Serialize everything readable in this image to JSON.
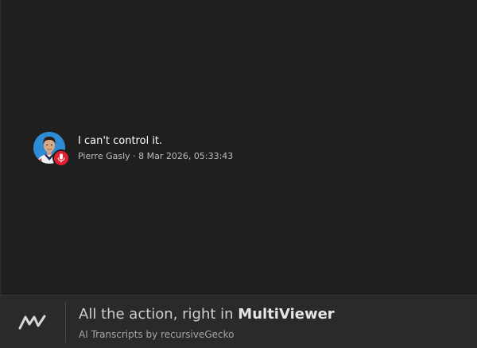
{
  "message": {
    "text": "I can't control it.",
    "author": "Pierre Gasly",
    "separator": " · ",
    "timestamp": "8 Mar 2026, 05:33:43",
    "avatar_icon": "driver-avatar",
    "badge_icon": "microphone-icon",
    "badge_color": "#e0202e"
  },
  "footer": {
    "tagline_prefix": "All the action, right in ",
    "tagline_brand": "MultiViewer",
    "credit": "AI Transcripts by recursiveGecko",
    "logo_icon": "multiviewer-logo"
  },
  "colors": {
    "background": "#1f1f1f",
    "footer_background": "#2a2a2a",
    "avatar_background": "#2f8bd4"
  }
}
